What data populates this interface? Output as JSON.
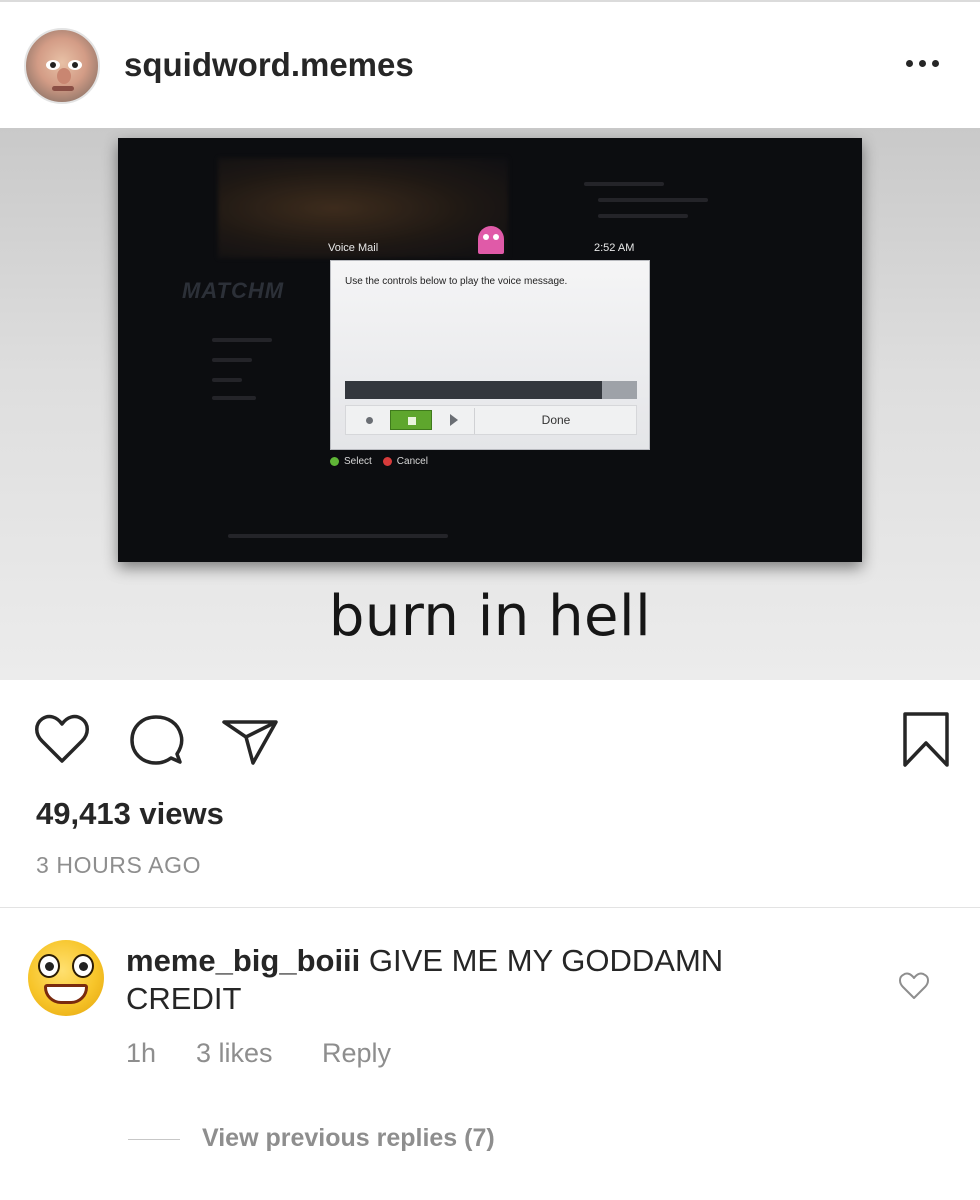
{
  "post": {
    "username": "squidword.memes",
    "more_icon": "more-dots-icon"
  },
  "media": {
    "caption": "burn in hell",
    "screen": {
      "blurred_word": "MATCHM",
      "dialog_title": "Voice Mail",
      "clock": "2:52 AM",
      "message": "Use the controls below to play the voice message.",
      "playback_progress": 0.88,
      "done_label": "Done",
      "select_label": "Select",
      "cancel_label": "Cancel"
    }
  },
  "actions": {
    "like_icon": "heart-icon",
    "comment_icon": "comment-icon",
    "share_icon": "send-icon",
    "save_icon": "bookmark-icon"
  },
  "stats": {
    "views": "49,413 views",
    "time": "3 HOURS AGO"
  },
  "comment": {
    "username": "meme_big_boiii",
    "text": "GIVE ME MY GODDAMN CREDIT",
    "age": "1h",
    "likes": "3 likes",
    "reply": "Reply",
    "view_replies": "View previous replies (7)"
  },
  "colors": {
    "text": "#262626",
    "muted": "#8e8e8e",
    "divider": "#dbdbdb"
  }
}
